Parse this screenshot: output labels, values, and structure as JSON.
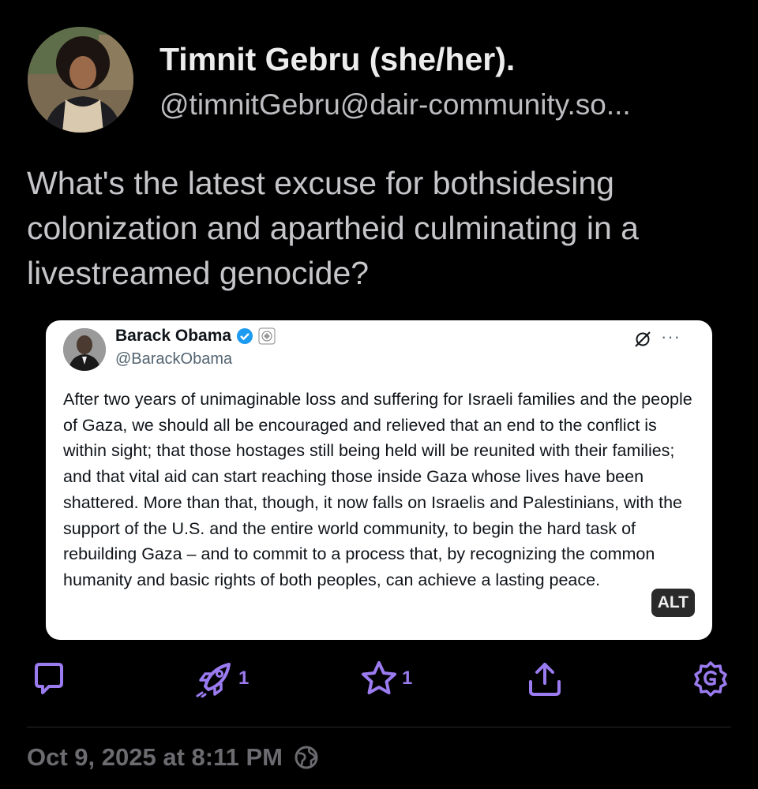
{
  "author": {
    "display_name": "Timnit Gebru (she/her).",
    "handle": "@timnitGebru@dair-community.so..."
  },
  "post": {
    "text": "What's the latest excuse for bothsidesing colonization and apartheid culminating in a livestreamed genocide?"
  },
  "embed": {
    "name": "Barack Obama",
    "handle": "@BarackObama",
    "more_label": "···",
    "text": "After two years of unimaginable loss and suffering for Israeli families and the people of Gaza, we should all be encouraged and relieved that an end to the conflict is within sight; that those hostages still being held will be reunited with their families; and that vital aid can start reaching those inside Gaza whose lives have been shattered. More than that, though, it now falls on Israelis and Palestinians, with the support of the U.S. and the entire world community, to begin the hard task of rebuilding Gaza – and to commit to a process that, by recognizing the common humanity and basic rights of both peoples, can achieve a lasting peace.",
    "alt_label": "ALT"
  },
  "actions": {
    "reply_icon": "reply-icon",
    "boost_icon": "boost-icon",
    "boost_count": "1",
    "favourite_icon": "star-icon",
    "favourite_count": "1",
    "share_icon": "share-icon",
    "more_icon": "gear-icon",
    "accent_color": "#9b7bf0"
  },
  "meta": {
    "timestamp": "Oct 9, 2025 at 8:11 PM",
    "visibility_icon": "globe-icon"
  }
}
